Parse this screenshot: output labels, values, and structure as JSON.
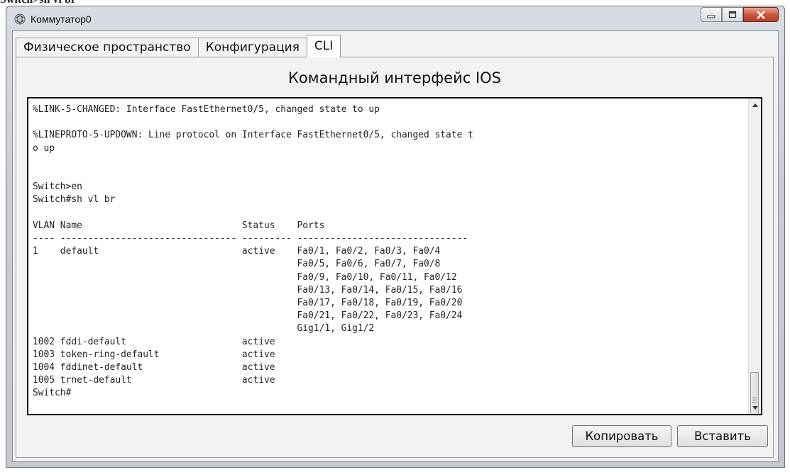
{
  "top_fragment": "Switch>sh vl br",
  "window": {
    "title": "Коммутатор0",
    "icon": "switch-icon",
    "controls": {
      "minimize": "minimize-icon",
      "maximize": "maximize-icon",
      "close": "close-icon"
    }
  },
  "tabs": [
    {
      "label": "Физическое пространство",
      "active": false
    },
    {
      "label": "Конфигурация",
      "active": false
    },
    {
      "label": "CLI",
      "active": true
    }
  ],
  "cli": {
    "heading": "Командный интерфейс IOS",
    "output": "%LINK-5-CHANGED: Interface FastEthernet0/5, changed state to up\n\n%LINEPROTO-5-UPDOWN: Line protocol on Interface FastEthernet0/5, changed state t\no up\n\n\nSwitch>en\nSwitch#sh vl br\n\nVLAN Name                             Status    Ports\n---- -------------------------------- --------- -------------------------------\n1    default                          active    Fa0/1, Fa0/2, Fa0/3, Fa0/4\n                                                Fa0/5, Fa0/6, Fa0/7, Fa0/8\n                                                Fa0/9, Fa0/10, Fa0/11, Fa0/12\n                                                Fa0/13, Fa0/14, Fa0/15, Fa0/16\n                                                Fa0/17, Fa0/18, Fa0/19, Fa0/20\n                                                Fa0/21, Fa0/22, Fa0/23, Fa0/24\n                                                Gig1/1, Gig1/2\n1002 fddi-default                     active\n1003 token-ring-default               active\n1004 fddinet-default                  active\n1005 trnet-default                    active\nSwitch#",
    "copy_label": "Копировать",
    "paste_label": "Вставить"
  }
}
